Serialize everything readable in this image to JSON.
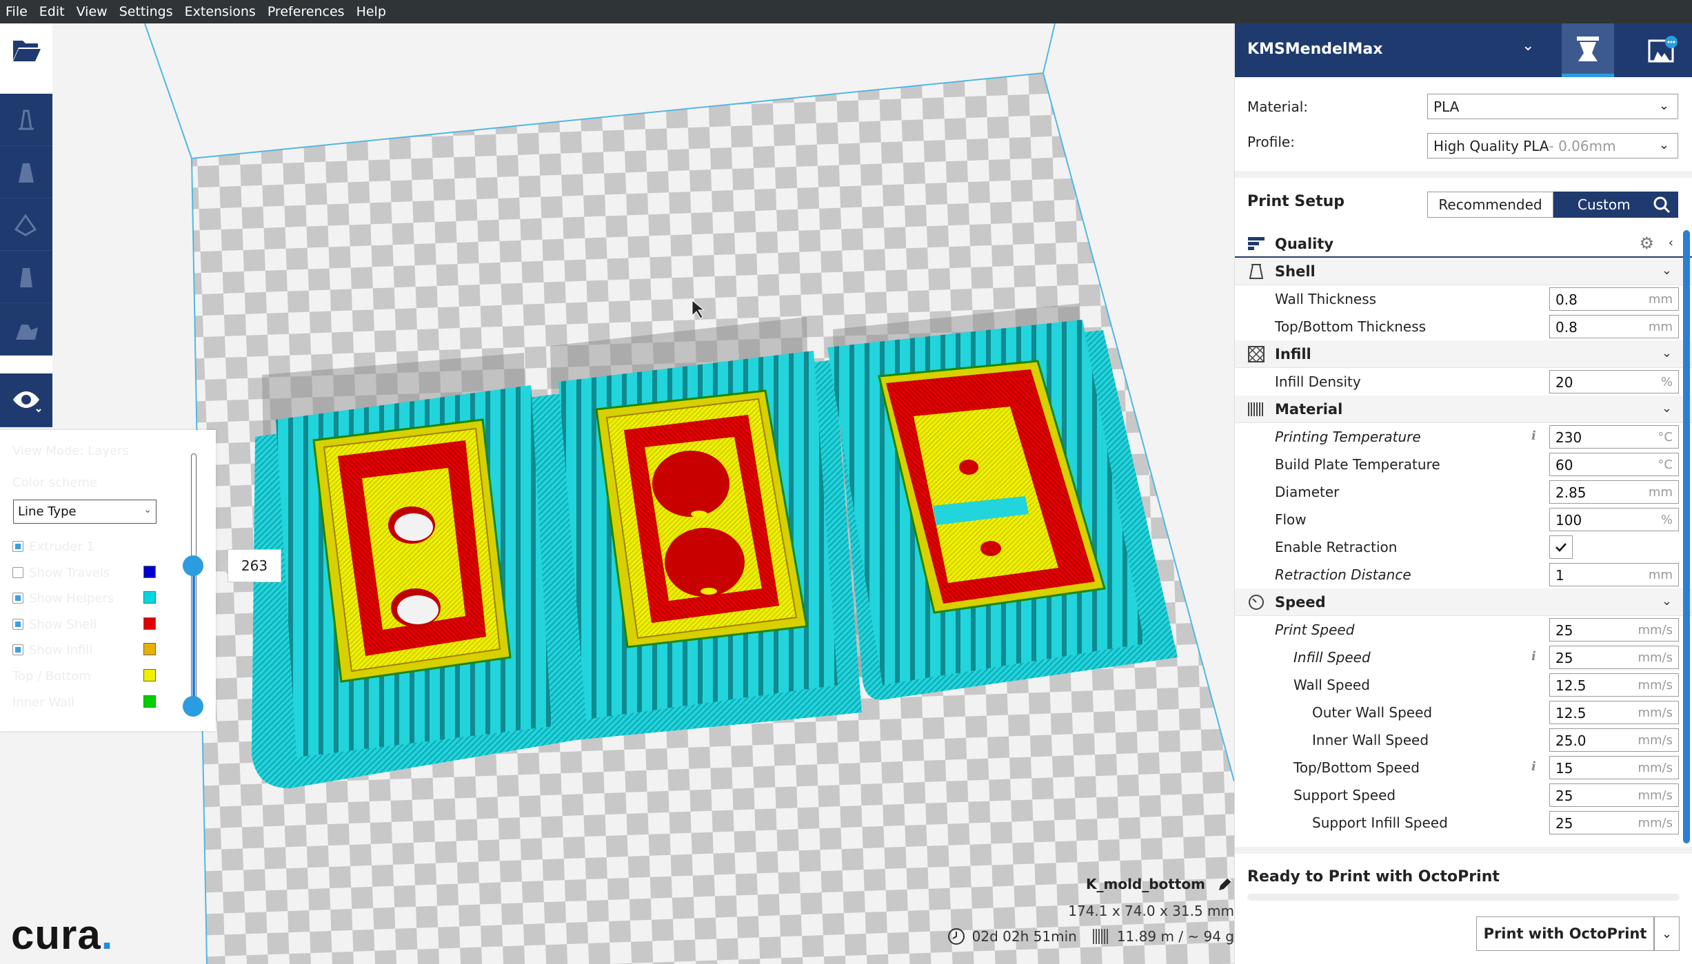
{
  "menu": [
    "File",
    "Edit",
    "View",
    "Settings",
    "Extensions",
    "Preferences",
    "Help"
  ],
  "layer_view": {
    "view_mode": "View Mode: Layers",
    "color_scheme_label": "Color scheme",
    "color_scheme_value": "Line Type",
    "options": [
      {
        "label": "Extruder 1",
        "checked": true
      },
      {
        "label": "Show Travels",
        "checked": false,
        "color": "#0000cc"
      },
      {
        "label": "Show Helpers",
        "checked": true,
        "color": "#00d8e0"
      },
      {
        "label": "Show Shell",
        "checked": true,
        "color": "#e00000"
      },
      {
        "label": "Show Infill",
        "checked": true,
        "color": "#e8b000"
      },
      {
        "label": "Top / Bottom",
        "color": "#f0f000"
      },
      {
        "label": "Inner Wall",
        "color": "#00d000"
      }
    ],
    "current_layer": "263"
  },
  "object": {
    "name": "K_mold_bottom",
    "dimensions": "174.1 x 74.0 x 31.5 mm",
    "print_time": "02d 02h 51min",
    "material_usage": "11.89 m / ~ 94 g"
  },
  "logo": {
    "text": "cura",
    "dot": "."
  },
  "sidebar": {
    "printer": "KMSMendelMax",
    "material_label": "Material:",
    "material_value": "PLA",
    "profile_label": "Profile:",
    "profile_value": "High Quality PLA",
    "profile_sub": " - 0.06mm",
    "print_setup": "Print Setup",
    "mode_recommended": "Recommended",
    "mode_custom": "Custom",
    "categories": {
      "quality": "Quality",
      "shell": "Shell",
      "infill": "Infill",
      "material": "Material",
      "speed": "Speed"
    },
    "settings": {
      "wall_thickness": {
        "label": "Wall Thickness",
        "value": "0.8",
        "unit": "mm"
      },
      "top_bottom_thickness": {
        "label": "Top/Bottom Thickness",
        "value": "0.8",
        "unit": "mm"
      },
      "infill_density": {
        "label": "Infill Density",
        "value": "20",
        "unit": "%"
      },
      "printing_temperature": {
        "label": "Printing Temperature",
        "value": "230",
        "unit": "°C"
      },
      "build_plate_temperature": {
        "label": "Build Plate Temperature",
        "value": "60",
        "unit": "°C"
      },
      "diameter": {
        "label": "Diameter",
        "value": "2.85",
        "unit": "mm"
      },
      "flow": {
        "label": "Flow",
        "value": "100",
        "unit": "%"
      },
      "enable_retraction": {
        "label": "Enable Retraction"
      },
      "retraction_distance": {
        "label": "Retraction Distance",
        "value": "1",
        "unit": "mm"
      },
      "print_speed": {
        "label": "Print Speed",
        "value": "25",
        "unit": "mm/s"
      },
      "infill_speed": {
        "label": "Infill Speed",
        "value": "25",
        "unit": "mm/s"
      },
      "wall_speed": {
        "label": "Wall Speed",
        "value": "12.5",
        "unit": "mm/s"
      },
      "outer_wall_speed": {
        "label": "Outer Wall Speed",
        "value": "12.5",
        "unit": "mm/s"
      },
      "inner_wall_speed": {
        "label": "Inner Wall Speed",
        "value": "25.0",
        "unit": "mm/s"
      },
      "top_bottom_speed": {
        "label": "Top/Bottom Speed",
        "value": "15",
        "unit": "mm/s"
      },
      "support_speed": {
        "label": "Support Speed",
        "value": "25",
        "unit": "mm/s"
      },
      "support_infill_speed": {
        "label": "Support Infill Speed",
        "value": "25",
        "unit": "mm/s"
      }
    },
    "status": "Ready to Print with OctoPrint",
    "print_button": "Print with OctoPrint"
  }
}
